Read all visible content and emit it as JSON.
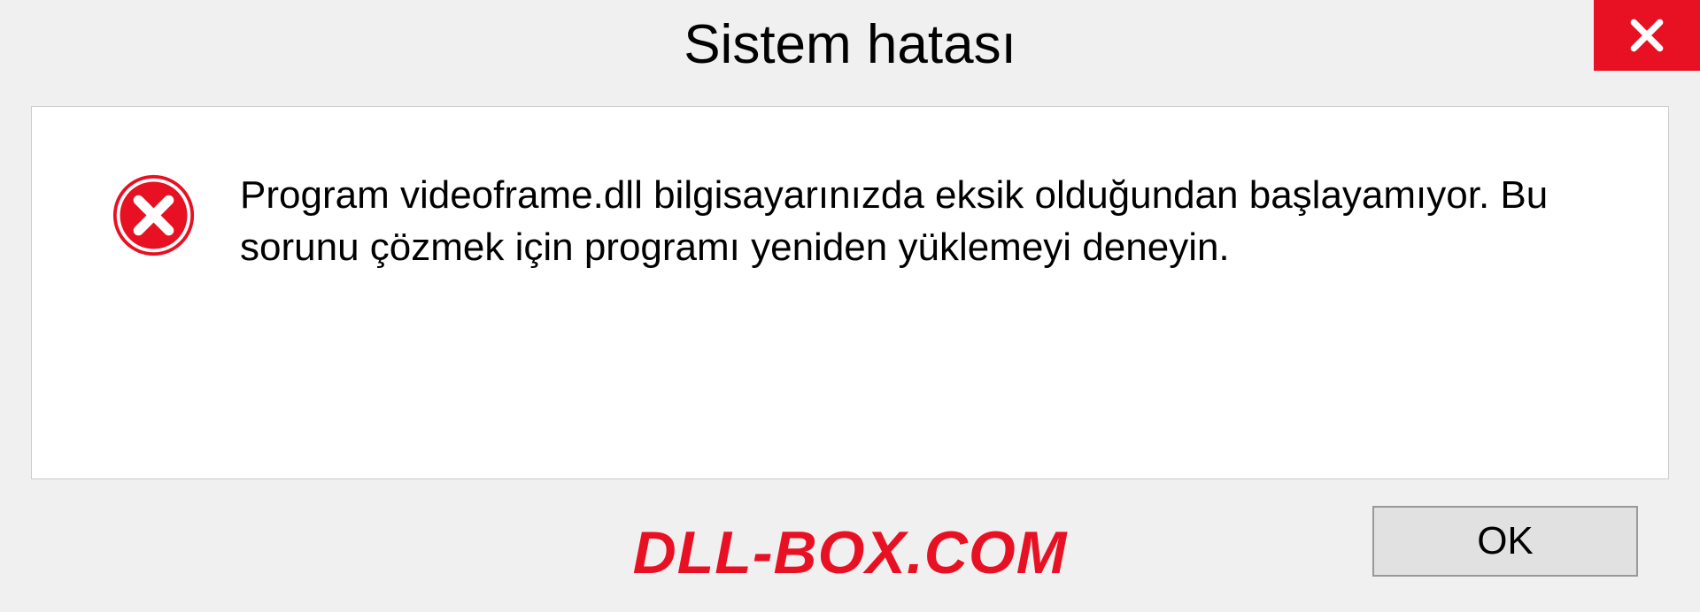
{
  "dialog": {
    "title": "Sistem hatası",
    "message": "Program videoframe.dll bilgisayarınızda eksik olduğundan başlayamıyor. Bu sorunu çözmek için programı yeniden yüklemeyi deneyin.",
    "ok_label": "OK"
  },
  "watermark": "DLL-BOX.COM"
}
